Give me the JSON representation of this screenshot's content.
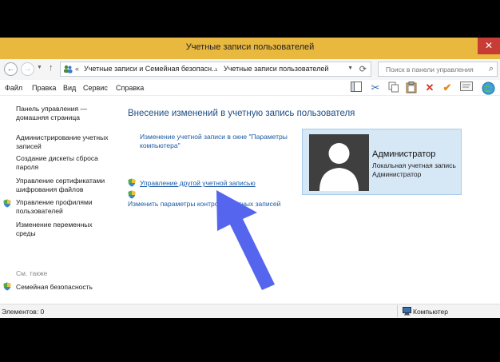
{
  "window": {
    "title": "Учетные записи пользователей",
    "close_glyph": "✕"
  },
  "address": {
    "overflow": "«",
    "crumbs": [
      "Учетные записи и Семейная безопасн...",
      "Учетные записи пользователей"
    ],
    "separator": "›",
    "search_placeholder": "Поиск в панели управления"
  },
  "menu": {
    "items": [
      "Файл",
      "Правка",
      "Вид",
      "Сервис",
      "Справка"
    ]
  },
  "sidebar": {
    "home": [
      "Панель управления —",
      "домашняя страница"
    ],
    "links": [
      [
        "Администрирование учетных",
        "записей"
      ],
      [
        "Создание дискеты сброса",
        "пароля"
      ],
      [
        "Управление сертификатами",
        "шифрования файлов"
      ],
      [
        "Управление профилями",
        "пользователей"
      ],
      [
        "Изменение переменных",
        "среды"
      ]
    ],
    "see_also": "См. также",
    "family_safety": "Семейная безопасность"
  },
  "main": {
    "heading": "Внесение изменений в учетную запись пользователя",
    "link_pc_settings": [
      "Изменение учетной записи в окне \"Параметры",
      "компьютера\""
    ],
    "link_manage_other": "Управление другой учетной записью",
    "link_uac": "Изменить параметры контроля учетных записей"
  },
  "account": {
    "name": "Администратор",
    "type": "Локальная учетная запись",
    "role": "Администратор"
  },
  "status": {
    "items_label": "Элементов: 0",
    "computer_label": "Компьютер"
  },
  "colors": {
    "titlebar": "#e9b83f",
    "link": "#1b5aa6",
    "heading": "#1e4c86",
    "card_bg": "#d6e7f6",
    "arrow": "#5565ee"
  }
}
